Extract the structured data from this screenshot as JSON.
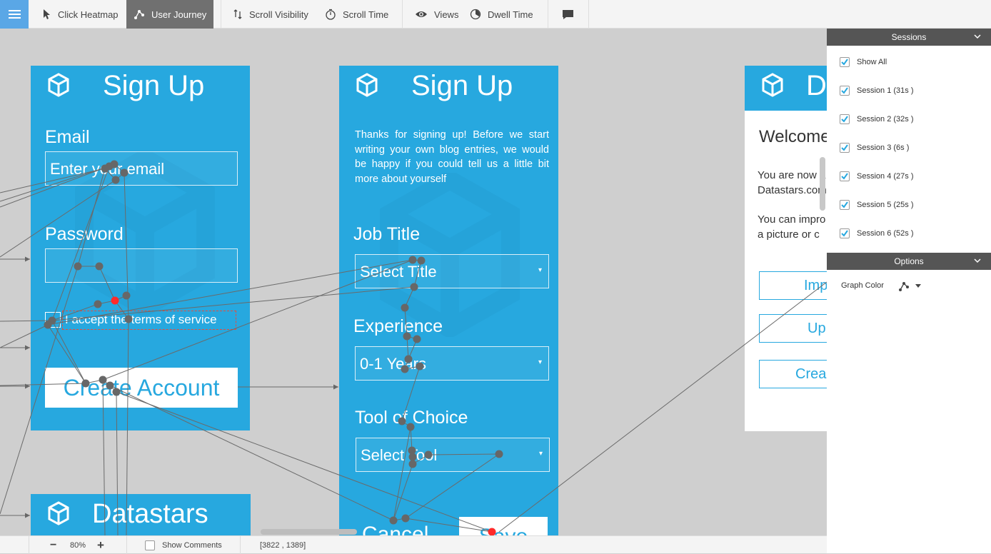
{
  "toolbar": {
    "menu_icon": "hamburger-icon",
    "click_heatmap": "Click Heatmap",
    "user_journey": "User Journey",
    "scroll_visibility": "Scroll Visibility",
    "scroll_time": "Scroll Time",
    "views": "Views",
    "dwell_time": "Dwell Time",
    "comment_icon": "comment-icon",
    "active_tab": "User Journey"
  },
  "screens": {
    "signup1": {
      "title": "Sign Up",
      "email_label": "Email",
      "email_placeholder": "Enter your email",
      "password_label": "Password",
      "terms": "I accept the terms of service",
      "create_account": "Create Account"
    },
    "signup2": {
      "title": "Sign Up",
      "intro": "Thanks for signing up! Before we start writing your own blog entries, we would be happy if you could tell us a little bit more about yourself",
      "job_title_label": "Job Title",
      "job_title_value": "Select Title",
      "experience_label": "Experience",
      "experience_value": "0-1 Years",
      "tool_label": "Tool of Choice",
      "tool_value": "Select Tool",
      "cancel": "Cancel",
      "save": "Save"
    },
    "dashboard": {
      "title_visible": "D",
      "welcome": "Welcome",
      "line1": "You are now a",
      "line2": "Datastars.com",
      "line3": "You can impro",
      "line4": "a picture or c",
      "btn1": "Imp",
      "btn2": "Up",
      "btn3": "Crea"
    },
    "datastars": {
      "title": "Datastars"
    }
  },
  "panel": {
    "sessions_header": "Sessions",
    "show_all": "Show All",
    "sessions": [
      {
        "label": "Session 1 (31s )",
        "checked": true
      },
      {
        "label": "Session 2 (32s )",
        "checked": true
      },
      {
        "label": "Session 3 (6s )",
        "checked": true
      },
      {
        "label": "Session 4 (27s )",
        "checked": true
      },
      {
        "label": "Session 5 (25s )",
        "checked": true
      },
      {
        "label": "Session 6 (52s )",
        "checked": true
      }
    ],
    "options_header": "Options",
    "graph_color": "Graph Color"
  },
  "bottombar": {
    "zoom": "80%",
    "show_comments": "Show Comments",
    "coordinates": "[3822 , 1389]"
  },
  "colors": {
    "accent": "#27a8df",
    "toolbar_active": "#707070",
    "menu_button": "#5aa7e6",
    "path_node": "#676767",
    "click_node": "#ff2a2a"
  }
}
